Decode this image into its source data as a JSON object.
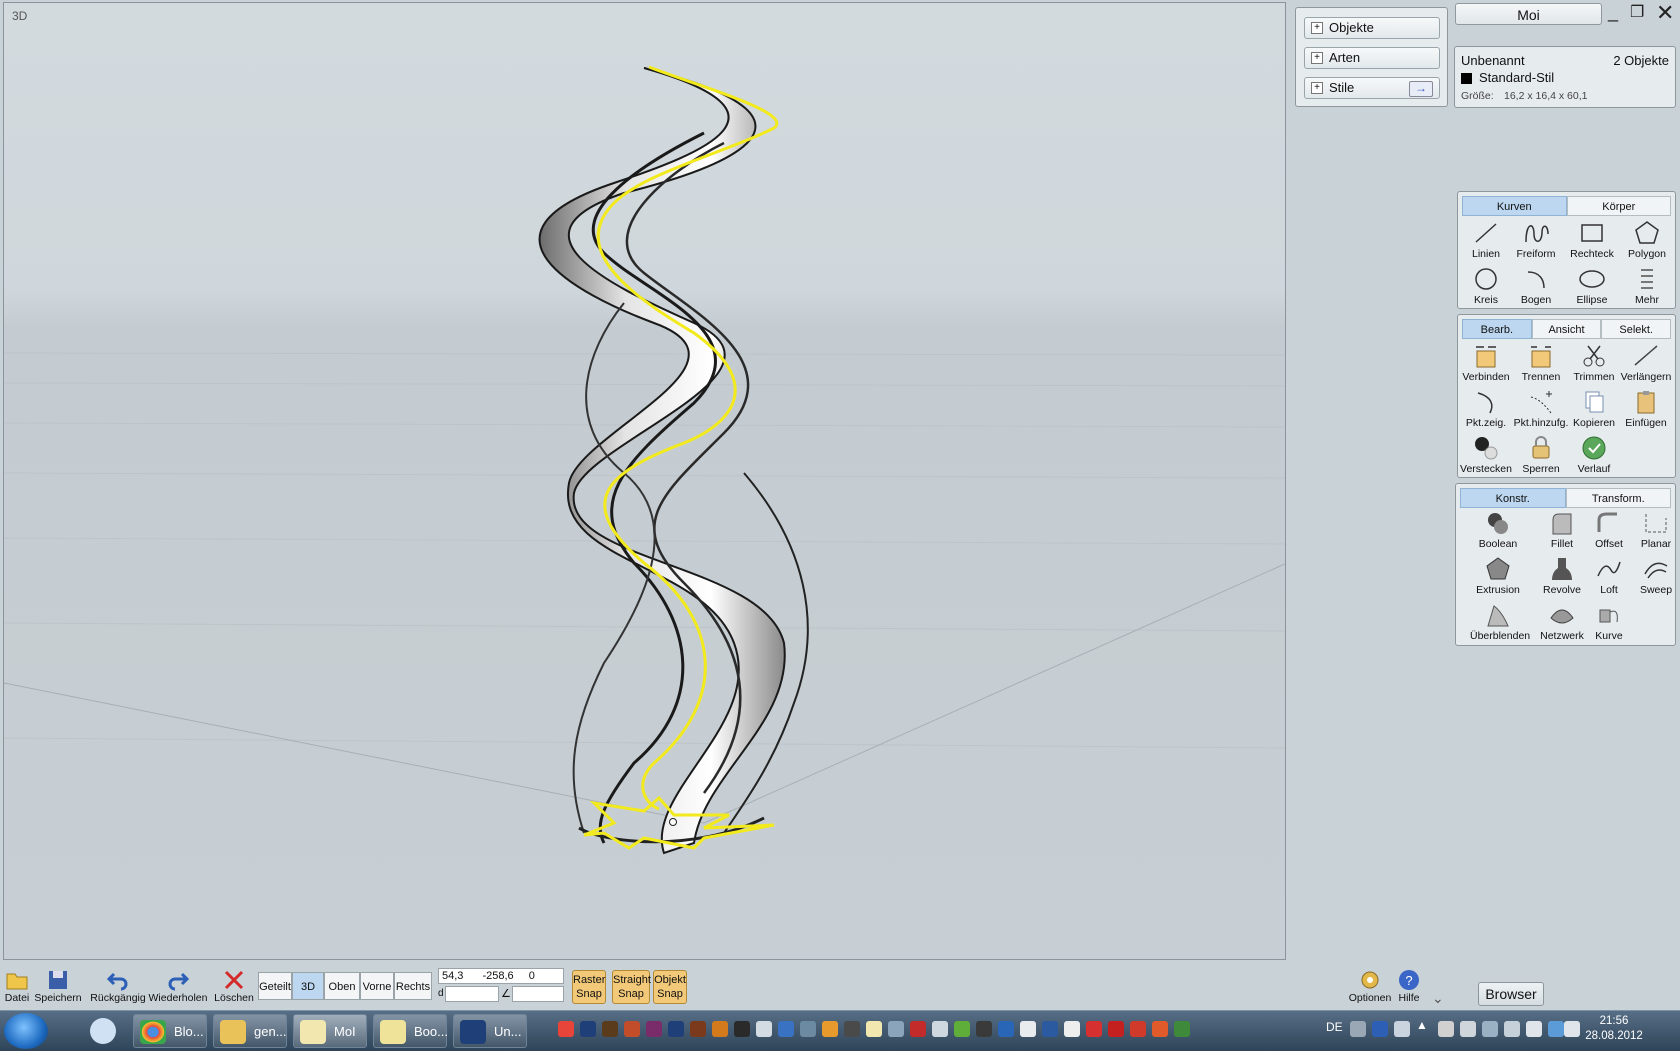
{
  "viewport": {
    "label": "3D"
  },
  "accordion": {
    "objects": "Objekte",
    "types": "Arten",
    "styles": "Stile"
  },
  "window": {
    "title": "Moi"
  },
  "info": {
    "name": "Unbenannt",
    "count": "2 Objekte",
    "style": "Standard-Stil",
    "size_label": "Größe:",
    "size_value": "16,2 x 16,4 x 60,1"
  },
  "curves_panel": {
    "tabs": [
      "Kurven",
      "Körper"
    ],
    "tools": [
      "Linien",
      "Freiform",
      "Rechteck",
      "Polygon",
      "Kreis",
      "Bogen",
      "Ellipse",
      "Mehr"
    ]
  },
  "edit_panel": {
    "tabs": [
      "Bearb.",
      "Ansicht",
      "Selekt."
    ],
    "tools": [
      "Verbinden",
      "Trennen",
      "Trimmen",
      "Verlängern",
      "Pkt.zeig.",
      "Pkt.hinzufg.",
      "Kopieren",
      "Einfügen",
      "Verstecken",
      "Sperren",
      "Verlauf"
    ]
  },
  "construct_panel": {
    "tabs": [
      "Konstr.",
      "Transform."
    ],
    "tools": [
      "Boolean",
      "Fillet",
      "Offset",
      "Planar",
      "Extrusion",
      "Revolve",
      "Loft",
      "Sweep",
      "Überblenden",
      "Netzwerk",
      "Kurve"
    ]
  },
  "bottom_toolbar": {
    "file": "Datei",
    "save": "Speichern",
    "undo": "Rückgängig",
    "redo": "Wiederholen",
    "delete": "Löschen",
    "views": [
      "Geteilt",
      "3D",
      "Oben",
      "Vorne",
      "Rechts"
    ],
    "coords": {
      "x": "54,3",
      "y": "-258,6",
      "z": "0",
      "d_label": "d",
      "angle_label": "∠"
    },
    "snaps": [
      [
        "Raster",
        "Snap"
      ],
      [
        "Straight",
        "Snap"
      ],
      [
        "Objekt",
        "Snap"
      ]
    ],
    "options": "Optionen",
    "help": "Hilfe",
    "browser": "Browser"
  },
  "taskbar": {
    "tasks": [
      "Blo...",
      "gen...",
      "MoI",
      "Boo...",
      "Un..."
    ],
    "lang": "DE",
    "time": "21:56",
    "date": "28.08.2012"
  },
  "colors": {
    "accent": "#bcd7ef",
    "curve_highlight": "#f2ea1c",
    "snap": "#f2c979"
  }
}
